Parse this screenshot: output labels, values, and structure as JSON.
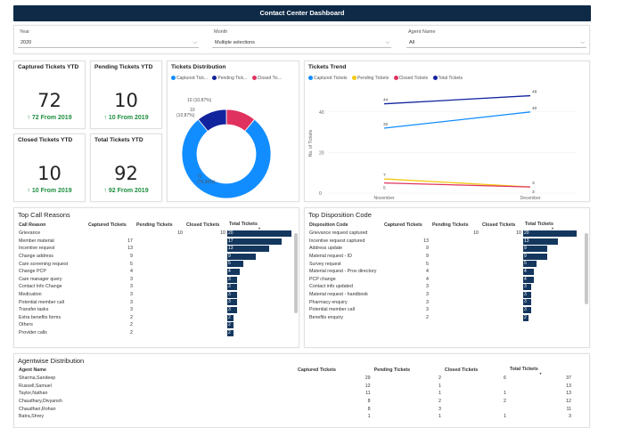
{
  "title": "Contact Center Dashboard",
  "filters": [
    {
      "label": "Year",
      "value": "2020"
    },
    {
      "label": "Month",
      "value": "Multiple selections"
    },
    {
      "label": "Agent Name",
      "value": "All"
    }
  ],
  "kpis": {
    "captured": {
      "title": "Captured Tickets YTD",
      "value": "72",
      "trend": "↑ 72 From 2019"
    },
    "pending": {
      "title": "Pending Tickets YTD",
      "value": "10",
      "trend": "↑ 10 From 2019"
    },
    "closed": {
      "title": "Closed Tickets YTD",
      "value": "10",
      "trend": "↑ 10 From 2019"
    },
    "total": {
      "title": "Total Tickets YTD",
      "value": "92",
      "trend": "↑ 92 From 2019"
    }
  },
  "distribution": {
    "title": "Tickets Distribution",
    "legend": [
      "Captured Tick...",
      "Pending Tick...",
      "Closed Tic..."
    ],
    "colors": [
      "#118dff",
      "#12239e",
      "#e0325f"
    ],
    "labels": [
      "72\n(78.26%)",
      "10 (10.87%)",
      "10\n(10.87%)"
    ]
  },
  "trend": {
    "title": "Tickets Trend",
    "legend": [
      "Captured Tickets",
      "Pending Tickets",
      "Closed Tickets",
      "Total Tickets"
    ],
    "colors": [
      "#118dff",
      "#f2c80f",
      "#e0325f",
      "#12239e"
    ],
    "ylabel": "No. of Tickets",
    "yticks": [
      "40",
      "20",
      "0"
    ],
    "xticks": [
      "November",
      "December"
    ]
  },
  "chart_data": [
    {
      "type": "pie",
      "title": "Tickets Distribution",
      "categories": [
        "Captured Tickets",
        "Pending Tickets",
        "Closed Tickets"
      ],
      "values": [
        72,
        10,
        10
      ],
      "percent": [
        78.26,
        10.87,
        10.87
      ]
    },
    {
      "type": "line",
      "title": "Tickets Trend",
      "x": [
        "November",
        "December"
      ],
      "ylabel": "No. of Tickets",
      "ylim": [
        0,
        50
      ],
      "series": [
        {
          "name": "Captured Tickets",
          "values": [
            32,
            40
          ]
        },
        {
          "name": "Pending Tickets",
          "values": [
            7,
            3
          ]
        },
        {
          "name": "Closed Tickets",
          "values": [
            5,
            3
          ]
        },
        {
          "name": "Total Tickets",
          "values": [
            44,
            48
          ]
        }
      ]
    }
  ],
  "callReasons": {
    "title": "Top Call Reasons",
    "columns": [
      "Call Reason",
      "Captured Tickets",
      "Pending Tickets",
      "Closed Tickets",
      "Total Tickets"
    ],
    "rows": [
      [
        "Grievance",
        "",
        "10",
        "10",
        "20"
      ],
      [
        "Member material",
        "17",
        "",
        "",
        "17"
      ],
      [
        "Incentive request",
        "13",
        "",
        "",
        "13"
      ],
      [
        "Change address",
        "9",
        "",
        "",
        "9"
      ],
      [
        "Care screening request",
        "5",
        "",
        "",
        "5"
      ],
      [
        "Change PCP",
        "4",
        "",
        "",
        "4"
      ],
      [
        "Care manager query",
        "3",
        "",
        "",
        "3"
      ],
      [
        "Contact Info Change",
        "3",
        "",
        "",
        "3"
      ],
      [
        "Medication",
        "3",
        "",
        "",
        "3"
      ],
      [
        "Potential member call",
        "3",
        "",
        "",
        "3"
      ],
      [
        "Transfer tasks",
        "3",
        "",
        "",
        "3"
      ],
      [
        "Extra benefits forms",
        "2",
        "",
        "",
        "2"
      ],
      [
        "Others",
        "2",
        "",
        "",
        "2"
      ],
      [
        "Provider calls",
        "2",
        "",
        "",
        "2"
      ]
    ]
  },
  "disposition": {
    "title": "Top Disposition Code",
    "columns": [
      "Disposition Code",
      "Captured Tickets",
      "Pending Tickets",
      "Closed Tickets",
      "Total Tickets"
    ],
    "rows": [
      [
        "Grievance request captured",
        "",
        "10",
        "10",
        "20"
      ],
      [
        "Incentive request captured",
        "13",
        "",
        "",
        "13"
      ],
      [
        "Address update",
        "9",
        "",
        "",
        "9"
      ],
      [
        "Material request - ID",
        "9",
        "",
        "",
        "9"
      ],
      [
        "Survey request",
        "5",
        "",
        "",
        "5"
      ],
      [
        "Material request - Prov directory",
        "4",
        "",
        "",
        "4"
      ],
      [
        "PCP change",
        "4",
        "",
        "",
        "4"
      ],
      [
        "Contact info updated",
        "3",
        "",
        "",
        "3"
      ],
      [
        "Material request - handbook",
        "3",
        "",
        "",
        "3"
      ],
      [
        "Pharmacy enquiry",
        "3",
        "",
        "",
        "3"
      ],
      [
        "Potential member call",
        "3",
        "",
        "",
        "3"
      ],
      [
        "Benefits enquiry",
        "2",
        "",
        "",
        "2"
      ]
    ]
  },
  "agents": {
    "title": "Agentwise Distribution",
    "columns": [
      "Agent Name",
      "Captured Tickets",
      "Pending Tickets",
      "Closed Tickets",
      "Total Tickets"
    ],
    "rows": [
      [
        "Sharma,Sandeep",
        "29",
        "2",
        "6",
        "37"
      ],
      [
        "Russell,Samuel",
        "12",
        "1",
        "",
        "13"
      ],
      [
        "Taylor,Nathan",
        "11",
        "1",
        "1",
        "13"
      ],
      [
        "Chaudhary,Divyansh",
        "8",
        "2",
        "2",
        "12"
      ],
      [
        "Chaudhari,Rohan",
        "8",
        "3",
        "",
        "11"
      ],
      [
        "Batra,Shrey",
        "1",
        "1",
        "1",
        "3"
      ]
    ]
  }
}
